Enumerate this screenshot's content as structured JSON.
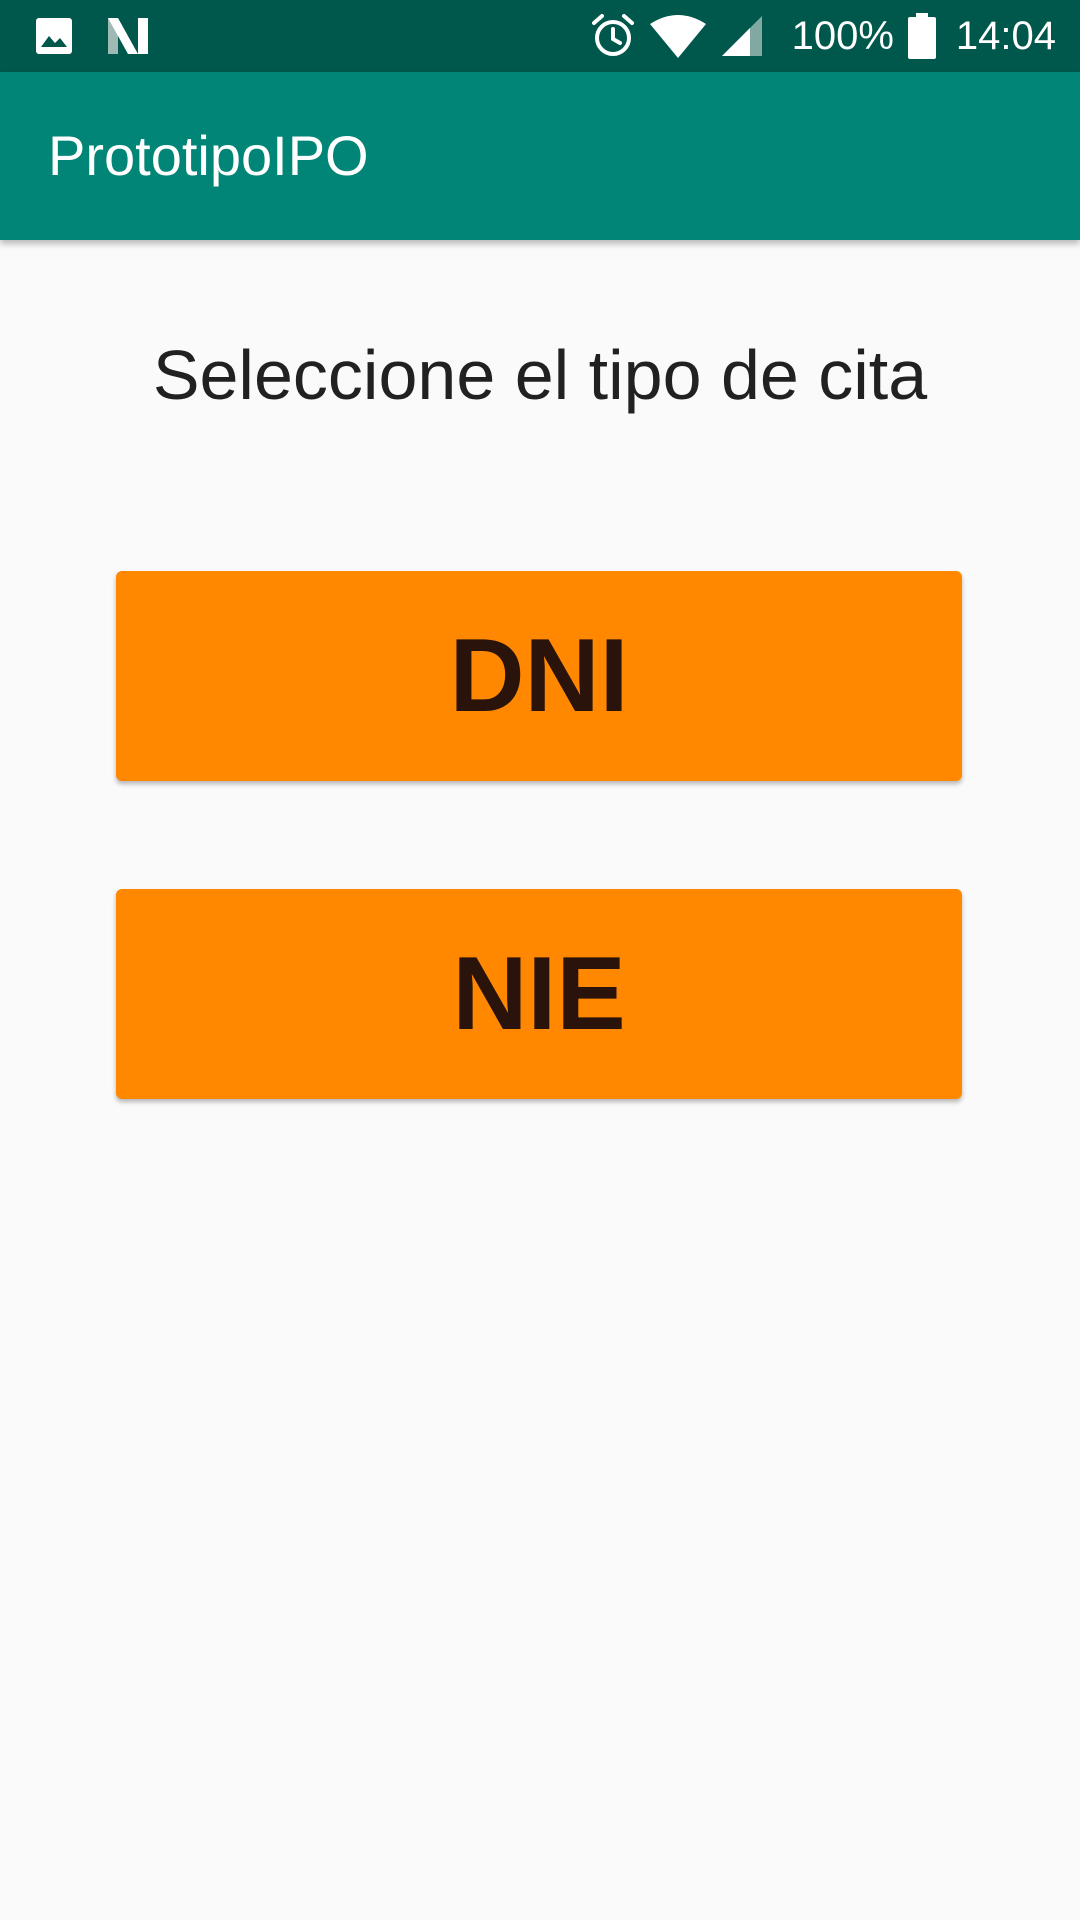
{
  "status_bar": {
    "left_icons": [
      "image-icon",
      "android-n-icon"
    ],
    "right_icons": [
      "alarm-icon",
      "wifi-icon",
      "cell-signal-icon"
    ],
    "battery_percent": "100%",
    "battery_icon": "battery-full-icon",
    "time": "14:04"
  },
  "app_bar": {
    "title": "PrototipoIPO"
  },
  "main": {
    "prompt": "Seleccione el tipo de cita",
    "buttons": [
      {
        "label": "DNI"
      },
      {
        "label": "NIE"
      }
    ]
  },
  "colors": {
    "status_bar": "#00574b",
    "app_bar": "#008577",
    "button": "#ff8800",
    "button_text": "#2a130a",
    "background": "#fafafa"
  }
}
